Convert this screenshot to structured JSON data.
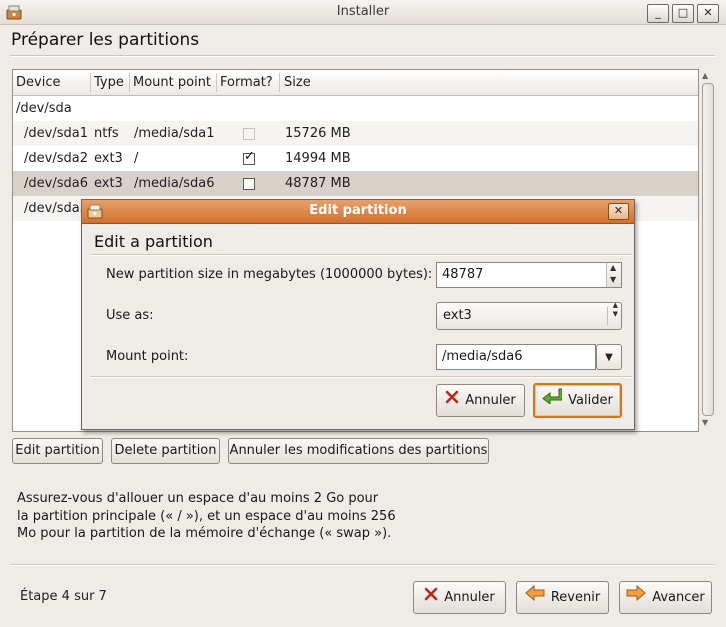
{
  "window": {
    "title": "Installer",
    "minimize": "_",
    "maximize": "□",
    "close": "✕"
  },
  "page_title": "Préparer les partitions",
  "table": {
    "columns": [
      "Device",
      "Type",
      "Mount point",
      "Format?",
      "Size"
    ],
    "disk": "/dev/sda",
    "rows": [
      {
        "device": "/dev/sda1",
        "type": "ntfs",
        "mount": "/media/sda1",
        "format": false,
        "format_enabled": false,
        "size": "15726 MB"
      },
      {
        "device": "/dev/sda2",
        "type": "ext3",
        "mount": "/",
        "format": true,
        "format_enabled": true,
        "size": "14994 MB"
      },
      {
        "device": "/dev/sda6",
        "type": "ext3",
        "mount": "/media/sda6",
        "format": false,
        "format_enabled": true,
        "size": "48787 MB"
      },
      {
        "device": "/dev/sda5",
        "type": "",
        "mount": "",
        "format": false,
        "format_enabled": true,
        "size": ""
      }
    ],
    "selected_row": 2
  },
  "actions": {
    "edit": "Edit partition",
    "delete": "Delete partition",
    "revert": "Annuler les modifications des partitions"
  },
  "info": "Assurez-vous d'allouer un espace d'au moins 2 Go pour\nla partition principale (« / »), et un espace d'au moins 256\nMo pour la partition de la mémoire d'échange (« swap »).",
  "footer": {
    "step": "Étape 4 sur 7",
    "cancel": "Annuler",
    "back": "Revenir",
    "forward": "Avancer"
  },
  "dialog": {
    "title": "Edit partition",
    "heading": "Edit a partition",
    "size_label": "New partition size in megabytes (1000000 bytes):",
    "size_value": "48787",
    "use_as_label": "Use as:",
    "use_as_value": "ext3",
    "mount_label": "Mount point:",
    "mount_value": "/media/sda6",
    "cancel": "Annuler",
    "ok": "Valider",
    "close": "✕"
  },
  "colors": {
    "accent": "#d2702d",
    "selection": "#d7d1ca",
    "focus": "#d2761c"
  },
  "icons": [
    "installer-icon",
    "cancel-x-icon",
    "back-arrow-icon",
    "forward-arrow-icon",
    "ok-enter-icon"
  ]
}
